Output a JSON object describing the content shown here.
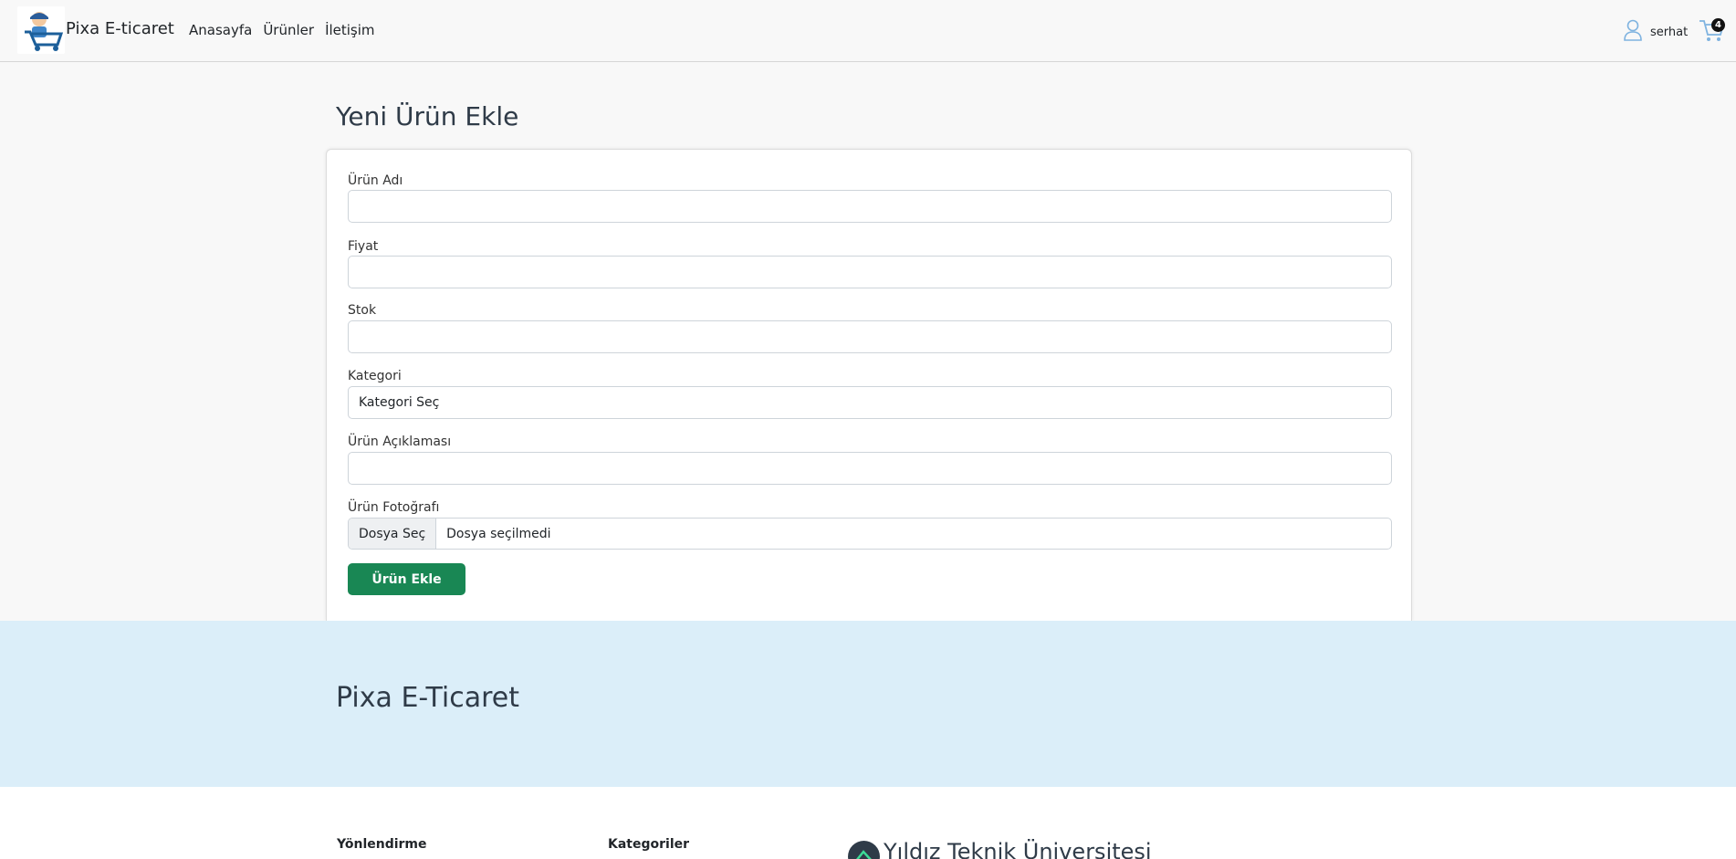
{
  "navbar": {
    "brand": "Pixa E-ticaret",
    "links": [
      "Anasayfa",
      "Ürünler",
      "İletişim"
    ],
    "user": "serhat",
    "cart_count": "4"
  },
  "main": {
    "title": "Yeni Ürün Ekle",
    "form": {
      "name_label": "Ürün Adı",
      "price_label": "Fiyat",
      "stock_label": "Stok",
      "category_label": "Kategori",
      "category_value": "Kategori Seç",
      "description_label": "Ürün Açıklaması",
      "photo_label": "Ürün Fotoğrafı",
      "file_button": "Dosya Seç",
      "file_status": "Dosya seçilmedi",
      "submit": "Ürün Ekle"
    }
  },
  "band": {
    "title": "Pixa E-Ticaret"
  },
  "footer": {
    "col1": "Yönlendirme",
    "col2": "Kategoriler",
    "university": "Yıldız Teknik Üniversitesi"
  },
  "colors": {
    "primary_button": "#198754",
    "band_bg": "#dbeef9"
  },
  "icons": [
    "brand-logo",
    "user-icon",
    "cart-icon"
  ]
}
